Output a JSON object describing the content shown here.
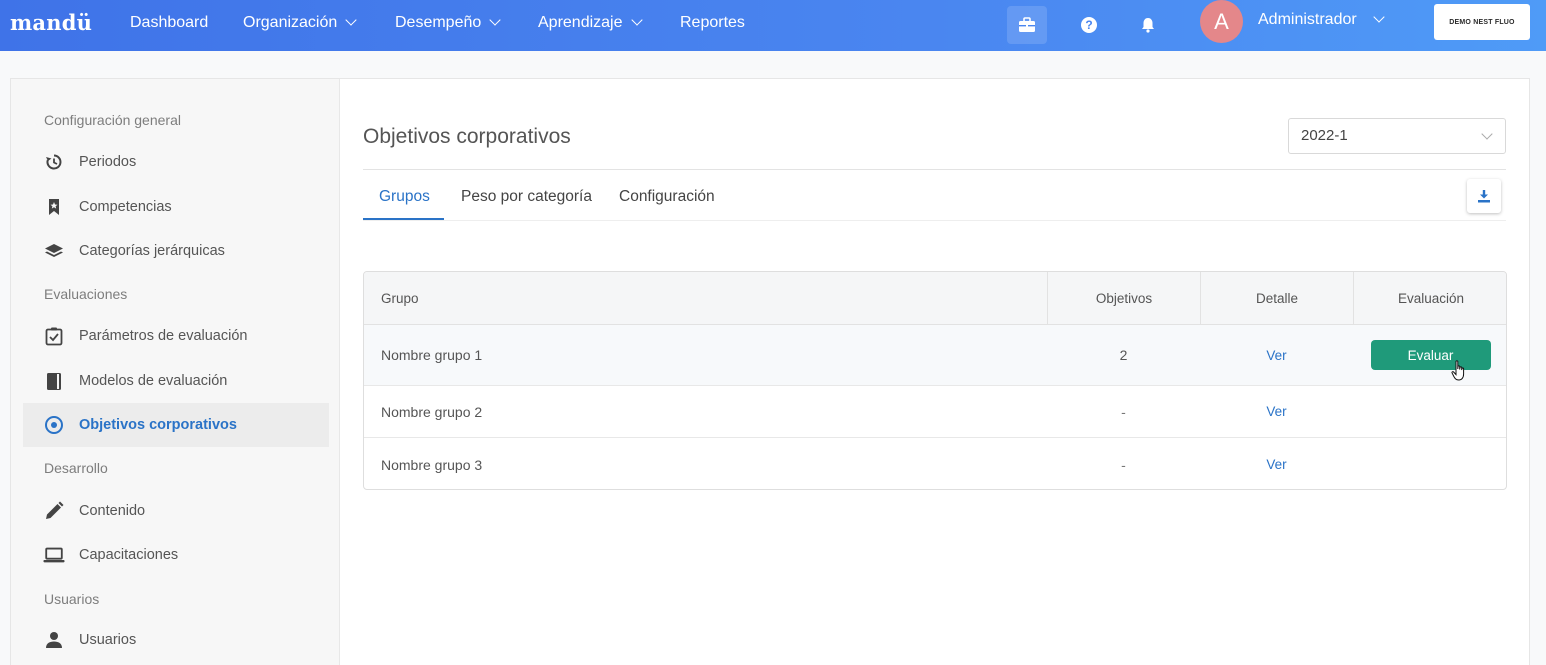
{
  "brand": {
    "logo": "mandü"
  },
  "nav": {
    "items": [
      {
        "label": "Dashboard"
      },
      {
        "label": "Organización"
      },
      {
        "label": "Desempeño"
      },
      {
        "label": "Aprendizaje"
      },
      {
        "label": "Reportes"
      }
    ],
    "user": {
      "avatar_letter": "A",
      "name": "Administrador"
    },
    "company": "DEMO NEST FLUO",
    "icons": [
      "briefcase-icon",
      "help-icon",
      "bell-icon"
    ]
  },
  "sidebar": {
    "sections": {
      "general": "Configuración general",
      "evaluaciones": "Evaluaciones",
      "desarrollo": "Desarrollo",
      "usuarios": "Usuarios"
    },
    "items": [
      {
        "label": "Periodos",
        "icon": "history-icon"
      },
      {
        "label": "Competencias",
        "icon": "bookmark-icon"
      },
      {
        "label": "Categorías jerárquicas",
        "icon": "layers-icon"
      },
      {
        "label": "Parámetros de evaluación",
        "icon": "checklist-icon"
      },
      {
        "label": "Modelos de evaluación",
        "icon": "book-icon"
      },
      {
        "label": "Objetivos corporativos",
        "icon": "target-icon",
        "active": true
      },
      {
        "label": "Contenido",
        "icon": "pencil-icon"
      },
      {
        "label": "Capacitaciones",
        "icon": "laptop-icon"
      },
      {
        "label": "Usuarios",
        "icon": "user-icon"
      }
    ]
  },
  "main": {
    "title": "Objetivos corporativos",
    "period": "2022-1",
    "tabs": [
      {
        "label": "Grupos",
        "active": true
      },
      {
        "label": "Peso por categoría"
      },
      {
        "label": "Configuración"
      }
    ],
    "table": {
      "headers": {
        "grupo": "Grupo",
        "objetivos": "Objetivos",
        "detalle": "Detalle",
        "evaluacion": "Evaluación"
      },
      "rows": [
        {
          "grupo": "Nombre grupo 1",
          "objetivos": "2",
          "detalle": "Ver",
          "evaluacion": "Evaluar"
        },
        {
          "grupo": "Nombre grupo 2",
          "objetivos": "-",
          "detalle": "Ver",
          "evaluacion": ""
        },
        {
          "grupo": "Nombre grupo 3",
          "objetivos": "-",
          "detalle": "Ver",
          "evaluacion": ""
        }
      ]
    }
  },
  "colors": {
    "nav_start": "#3f73e8",
    "nav_end": "#4f9bf7",
    "accent": "#2a73c7",
    "evaluate": "#1f9a7a"
  }
}
